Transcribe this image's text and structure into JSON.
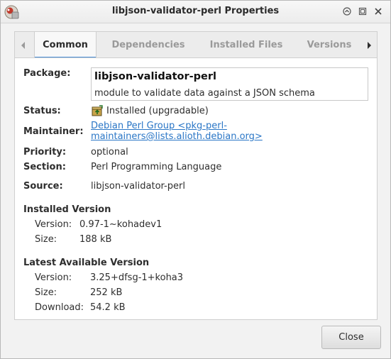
{
  "window": {
    "title": "libjson-validator-perl Properties"
  },
  "tabs": {
    "items": [
      {
        "label": "Common",
        "active": true
      },
      {
        "label": "Dependencies",
        "active": false
      },
      {
        "label": "Installed Files",
        "active": false
      },
      {
        "label": "Versions",
        "active": false
      }
    ]
  },
  "common": {
    "package_label": "Package:",
    "package_name": "libjson-validator-perl",
    "package_description": "module to validate data against a JSON schema",
    "status_label": "Status:",
    "status_value": "Installed (upgradable)",
    "maintainer_label": "Maintainer:",
    "maintainer_line1": "Debian Perl Group <pkg-perl-",
    "maintainer_line2": "maintainers@lists.alioth.debian.org>",
    "priority_label": "Priority:",
    "priority_value": "optional",
    "section_label": "Section:",
    "section_value": "Perl Programming Language",
    "source_label": "Source:",
    "source_value": "libjson-validator-perl"
  },
  "installed_version": {
    "heading": "Installed Version",
    "version_label": "Version:",
    "version_value": "0.97-1~kohadev1",
    "size_label": "Size:",
    "size_value": "188 kB"
  },
  "latest_version": {
    "heading": "Latest Available Version",
    "version_label": "Version:",
    "version_value": "3.25+dfsg-1+koha3",
    "size_label": "Size:",
    "size_value": "252 kB",
    "download_label": "Download:",
    "download_value": "54.2 kB"
  },
  "footer": {
    "close_label": "Close"
  },
  "icons": {
    "app": "synaptic-package-icon",
    "status": "package-upgradable-icon",
    "tab_prev": "chevron-left-icon",
    "tab_next": "chevron-right-icon"
  },
  "colors": {
    "accent": "#4a90d9",
    "link": "#2a76c6"
  }
}
